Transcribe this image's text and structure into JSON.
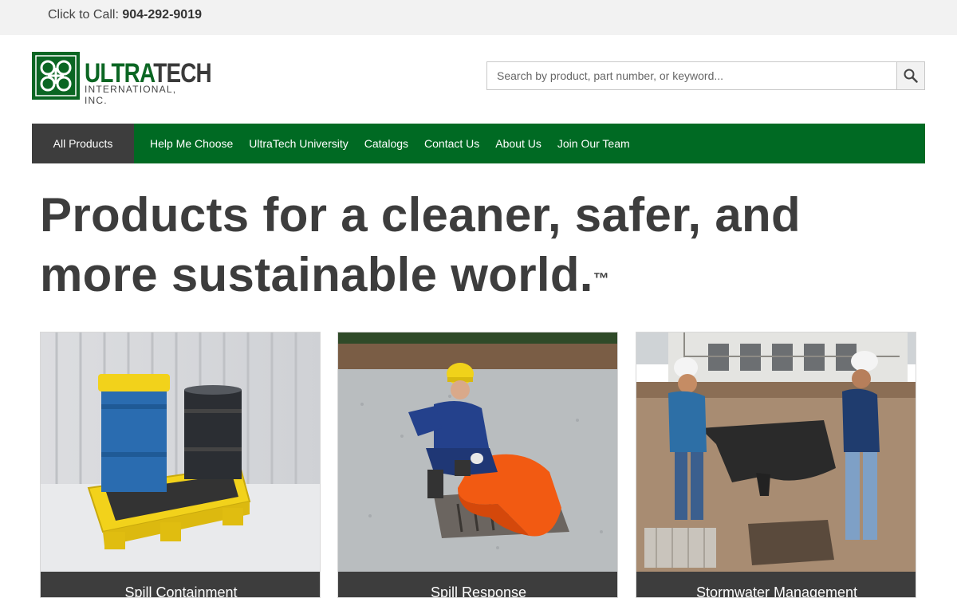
{
  "topbar": {
    "call_label": "Click to Call:",
    "phone": "904-292-9019"
  },
  "logo": {
    "word_ultra": "ULTRA",
    "word_tech": "TECH",
    "sub": "INTERNATIONAL, INC."
  },
  "search": {
    "placeholder": "Search by product, part number, or keyword...",
    "icon": "search-icon"
  },
  "nav": {
    "all_products": "All Products",
    "items": [
      "Help Me Choose",
      "UltraTech University",
      "Catalogs",
      "Contact Us",
      "About Us",
      "Join Our Team"
    ]
  },
  "hero": {
    "line1": "Products for a cleaner, safer, and",
    "line2": "more sustainable world.",
    "mark": "™"
  },
  "cards": [
    {
      "label": "Spill Containment"
    },
    {
      "label": "Spill Response"
    },
    {
      "label": "Stormwater Management"
    }
  ],
  "colors": {
    "brand_green": "#006a23",
    "dark_gray": "#3d3d3d",
    "topbar_bg": "#f2f2f2"
  }
}
